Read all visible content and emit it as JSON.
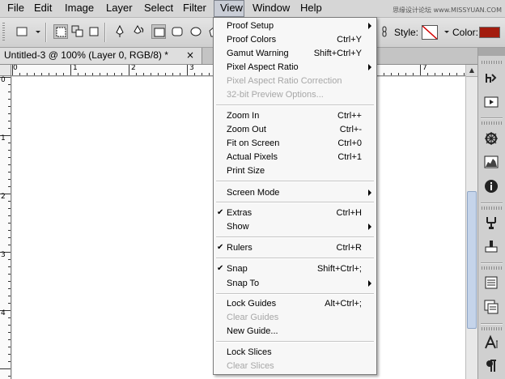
{
  "menubar": {
    "items": [
      {
        "label": "File"
      },
      {
        "label": "Edit"
      },
      {
        "label": "Image"
      },
      {
        "label": "Layer"
      },
      {
        "label": "Select"
      },
      {
        "label": "Filter"
      },
      {
        "label": "View"
      },
      {
        "label": "Window"
      },
      {
        "label": "Help"
      }
    ],
    "active": "View",
    "watermark": "思缘设计论坛 www.MISSYUAN.COM"
  },
  "options_bar": {
    "style_label": "Style:",
    "color_label": "Color:",
    "color_value": "#a31c0e",
    "icons": [
      "marquee-tool-icon",
      "dropdown-arrow-icon",
      "new-selection-icon",
      "add-selection-icon",
      "subtract-selection-icon",
      "pen-tool-icon",
      "freeform-pen-icon",
      "rectangle-shape-icon",
      "rounded-rectangle-icon",
      "ellipse-shape-icon",
      "link-icon"
    ]
  },
  "document": {
    "tab_title": "Untitled-3 @ 100% (Layer 0, RGB/8) *",
    "close_glyph": "×",
    "hruler_labels": [
      "0",
      "1",
      "2",
      "3",
      "7"
    ],
    "vruler_labels": [
      "0",
      "1",
      "2",
      "3",
      "4"
    ]
  },
  "view_menu": {
    "items": [
      {
        "label": "Proof Setup",
        "shortcut": "",
        "submenu": true,
        "enabled": true,
        "checked": false
      },
      {
        "label": "Proof Colors",
        "shortcut": "Ctrl+Y",
        "submenu": false,
        "enabled": true,
        "checked": false
      },
      {
        "label": "Gamut Warning",
        "shortcut": "Shift+Ctrl+Y",
        "submenu": false,
        "enabled": true,
        "checked": false
      },
      {
        "label": "Pixel Aspect Ratio",
        "shortcut": "",
        "submenu": true,
        "enabled": true,
        "checked": false
      },
      {
        "label": "Pixel Aspect Ratio Correction",
        "shortcut": "",
        "submenu": false,
        "enabled": false,
        "checked": false
      },
      {
        "label": "32-bit Preview Options...",
        "shortcut": "",
        "submenu": false,
        "enabled": false,
        "checked": false
      },
      {
        "label": "Zoom In",
        "shortcut": "Ctrl++",
        "submenu": false,
        "enabled": true,
        "checked": false
      },
      {
        "label": "Zoom Out",
        "shortcut": "Ctrl+-",
        "submenu": false,
        "enabled": true,
        "checked": false
      },
      {
        "label": "Fit on Screen",
        "shortcut": "Ctrl+0",
        "submenu": false,
        "enabled": true,
        "checked": false
      },
      {
        "label": "Actual Pixels",
        "shortcut": "Ctrl+1",
        "submenu": false,
        "enabled": true,
        "checked": false
      },
      {
        "label": "Print Size",
        "shortcut": "",
        "submenu": false,
        "enabled": true,
        "checked": false
      },
      {
        "label": "Screen Mode",
        "shortcut": "",
        "submenu": true,
        "enabled": true,
        "checked": false
      },
      {
        "label": "Extras",
        "shortcut": "Ctrl+H",
        "submenu": false,
        "enabled": true,
        "checked": true
      },
      {
        "label": "Show",
        "shortcut": "",
        "submenu": true,
        "enabled": true,
        "checked": false
      },
      {
        "label": "Rulers",
        "shortcut": "Ctrl+R",
        "submenu": false,
        "enabled": true,
        "checked": true
      },
      {
        "label": "Snap",
        "shortcut": "Shift+Ctrl+;",
        "submenu": false,
        "enabled": true,
        "checked": true
      },
      {
        "label": "Snap To",
        "shortcut": "",
        "submenu": true,
        "enabled": true,
        "checked": false
      },
      {
        "label": "Lock Guides",
        "shortcut": "Alt+Ctrl+;",
        "submenu": false,
        "enabled": true,
        "checked": false
      },
      {
        "label": "Clear Guides",
        "shortcut": "",
        "submenu": false,
        "enabled": false,
        "checked": false
      },
      {
        "label": "New Guide...",
        "shortcut": "",
        "submenu": false,
        "enabled": true,
        "checked": false
      },
      {
        "label": "Lock Slices",
        "shortcut": "",
        "submenu": false,
        "enabled": true,
        "checked": false
      },
      {
        "label": "Clear Slices",
        "shortcut": "",
        "submenu": false,
        "enabled": false,
        "checked": false
      }
    ],
    "check_glyph": "✔"
  },
  "right_dock": {
    "icons": [
      "history-icon",
      "actions-icon",
      "navigator-icon",
      "histogram-icon",
      "info-icon",
      "clone-source-icon",
      "tool-presets-icon",
      "layer-comps-icon",
      "paragraph-styles-icon",
      "character-icon",
      "paragraph-icon"
    ]
  }
}
